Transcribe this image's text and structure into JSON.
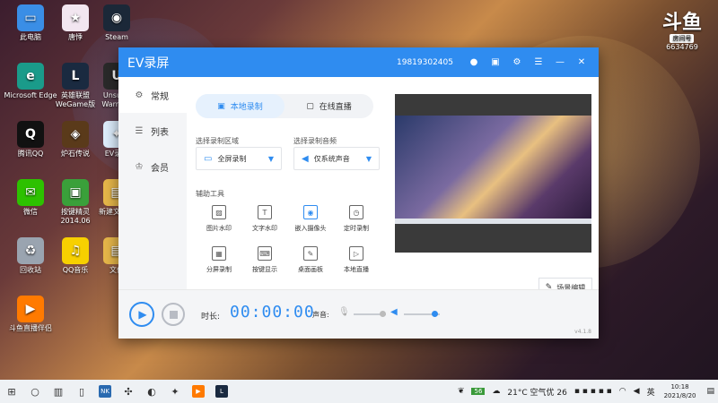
{
  "desktop": {
    "icons": [
      {
        "label": "此电脑",
        "icon": "computer-icon",
        "color": "#3a8ee6",
        "glyph": "▭"
      },
      {
        "label": "唐悸",
        "icon": "anime-app-icon",
        "color": "#f2e6f0",
        "glyph": "★"
      },
      {
        "label": "Steam",
        "icon": "steam-icon",
        "color": "#1b2838",
        "glyph": "◉"
      },
      {
        "label": "Microsoft Edge",
        "icon": "edge-icon",
        "color": "#1a9b8a",
        "glyph": "e"
      },
      {
        "label": "英雄联盟 WeGame版",
        "icon": "lol-icon",
        "color": "#1a2a40",
        "glyph": "L"
      },
      {
        "label": "Unsung Warriors",
        "icon": "game-icon",
        "color": "#2a2a2a",
        "glyph": "U"
      },
      {
        "label": "腾讯QQ",
        "icon": "qq-icon",
        "color": "#111",
        "glyph": "Q"
      },
      {
        "label": "炉石传说",
        "icon": "hearthstone-icon",
        "color": "#5a3a1a",
        "glyph": "◈"
      },
      {
        "label": "EV录屏",
        "icon": "ev-recorder-icon",
        "color": "#dff0ff",
        "glyph": "✦"
      },
      {
        "label": "微信",
        "icon": "wechat-icon",
        "color": "#2dc100",
        "glyph": "✉"
      },
      {
        "label": "按键精灵2014.06",
        "icon": "key-sprite-icon",
        "color": "#3aa03a",
        "glyph": "▣"
      },
      {
        "label": "新建文件夹",
        "icon": "folder-icon",
        "color": "#e8b84a",
        "glyph": "▤"
      },
      {
        "label": "回收站",
        "icon": "recycle-bin-icon",
        "color": "#9aa4b0",
        "glyph": "♻"
      },
      {
        "label": "QQ音乐",
        "icon": "qq-music-icon",
        "color": "#f7d000",
        "glyph": "♫"
      },
      {
        "label": "文件",
        "icon": "folder-icon",
        "color": "#e8b84a",
        "glyph": "▤"
      },
      {
        "label": "斗鱼直播伴侣",
        "icon": "douyu-companion-icon",
        "color": "#ff7a00",
        "glyph": "▶"
      }
    ],
    "douyu": {
      "logo": "斗鱼",
      "room_label": "房间号",
      "room_number": "6634769"
    }
  },
  "window": {
    "title": "EV录屏",
    "user_id": "19819302405",
    "sidebar": [
      {
        "label": "常规",
        "icon": "settings-sliders-icon",
        "active": true
      },
      {
        "label": "列表",
        "icon": "list-icon",
        "active": false
      },
      {
        "label": "会员",
        "icon": "crown-icon",
        "active": false
      }
    ],
    "tabs": [
      {
        "label": "本地录制",
        "icon": "record-icon",
        "active": true
      },
      {
        "label": "在线直播",
        "icon": "live-icon",
        "active": false
      }
    ],
    "region": {
      "label": "选择录制区域",
      "value": "全屏录制"
    },
    "audio": {
      "label": "选择录制音频",
      "value": "仅系统声音"
    },
    "tools_label": "辅助工具",
    "tools": [
      {
        "label": "图片水印",
        "icon": "image-watermark-icon",
        "glyph": "▨"
      },
      {
        "label": "文字水印",
        "icon": "text-watermark-icon",
        "glyph": "T"
      },
      {
        "label": "嵌入摄像头",
        "icon": "camera-icon",
        "glyph": "◉"
      },
      {
        "label": "定时录制",
        "icon": "timer-icon",
        "glyph": "◷"
      },
      {
        "label": "分屏录制",
        "icon": "split-screen-icon",
        "glyph": "▦"
      },
      {
        "label": "按键显示",
        "icon": "keyboard-icon",
        "glyph": "⌨"
      },
      {
        "label": "桌面画板",
        "icon": "drawing-board-icon",
        "glyph": "✎"
      },
      {
        "label": "本地直播",
        "icon": "local-live-icon",
        "glyph": "▷"
      }
    ],
    "scene_edit": "场景编辑",
    "duration_label": "时长:",
    "timer": "00:00:00",
    "volume_label": "声音:",
    "mic_volume_fraction": 0.9,
    "speaker_volume_fraction": 0.85,
    "version": "v4.1.8"
  },
  "taskbar": {
    "weather": "21°C  空气优 26",
    "battery": "56",
    "ime": "英",
    "time": "10:18",
    "date": "2021/8/20"
  }
}
